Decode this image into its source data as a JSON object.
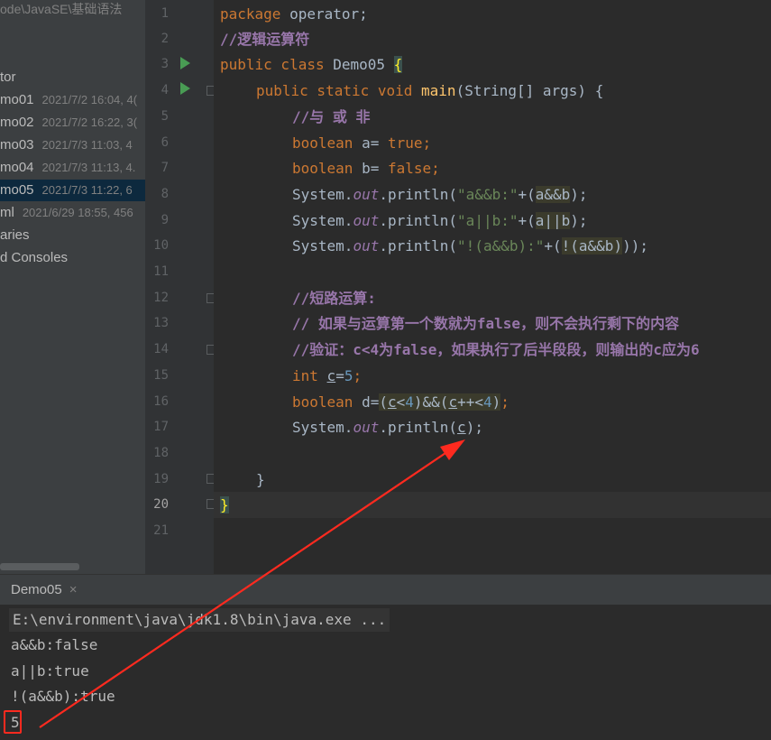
{
  "project": {
    "path": "ode\\JavaSE\\基础语法",
    "folder": "tor",
    "files": [
      {
        "name": "mo01",
        "meta": "2021/7/2 16:04, 4("
      },
      {
        "name": "mo02",
        "meta": "2021/7/2 16:22, 3("
      },
      {
        "name": "mo03",
        "meta": "2021/7/3 11:03, 4"
      },
      {
        "name": "mo04",
        "meta": "2021/7/3 11:13, 4."
      },
      {
        "name": "mo05",
        "meta": "2021/7/3 11:22, 6"
      }
    ],
    "iml": {
      "name": "ml",
      "meta": "2021/6/29 18:55, 456"
    },
    "libraries": "aries",
    "consoles": "d Consoles"
  },
  "editor": {
    "line_numbers": [
      "1",
      "2",
      "3",
      "4",
      "5",
      "6",
      "7",
      "8",
      "9",
      "10",
      "11",
      "12",
      "13",
      "14",
      "15",
      "16",
      "17",
      "18",
      "19",
      "20",
      "21"
    ],
    "current_line": "20",
    "code": {
      "l1_kw": "package",
      "l1_rest": " operator;",
      "l2": "//逻辑运算符",
      "l3_kw": "public class",
      "l3_name": " Demo05 ",
      "l3_brace": "{",
      "l4_kw": "public static void",
      "l4_fn": "main",
      "l4_rest": "(String[] args) {",
      "l5": "//与 或 非",
      "l6_kw": "boolean",
      "l6_mid": " a= ",
      "l6_val": "true",
      "l6_end": ";",
      "l7_kw": "boolean",
      "l7_mid": " b= ",
      "l7_val": "false",
      "l7_end": ";",
      "sys": "System.",
      "out": "out",
      "println": ".println(",
      "l8_str": "\"a&&b:\"",
      "l8_plus": "+(",
      "l8_expr": "a&&b",
      "l8_end": ");",
      "l9_str": "\"a||b:\"",
      "l9_plus": "+(",
      "l9_expr": "a||b",
      "l9_end": ");",
      "l10_str": "\"!(a&&b):\"",
      "l10_plus": "+(",
      "l10_expr": "!(a&&b)",
      "l10_end": "));",
      "l12": "//短路运算:",
      "l13": "// 如果与运算第一个数就为false，则不会执行剩下的内容",
      "l14": "//验证：c<4为false，如果执行了后半段段，则输出的c应为6",
      "l15_kw": "int",
      "l15_var": "c",
      "l15_eq": "=",
      "l15_num": "5",
      "l15_end": ";",
      "l16_kw": "boolean",
      "l16_var": " d=",
      "l16_expr_a": "(",
      "l16_c1": "c",
      "l16_lt": "<",
      "l16_n1": "4",
      "l16_mid": ")&&(",
      "l16_c2": "c",
      "l16_pp": "++<",
      "l16_n2": "4",
      "l16_close": ")",
      "l16_end": ";",
      "l17_arg": "c",
      "l17_end": ");",
      "l19": "}",
      "l20": "}"
    }
  },
  "run": {
    "tab": "Demo05",
    "close": "×",
    "command": "E:\\environment\\java\\jdk1.8\\bin\\java.exe ...",
    "output": [
      "a&&b:false",
      "a||b:true",
      "!(a&&b):true",
      "5"
    ]
  },
  "annotation": {
    "color": "#ff2a1f"
  }
}
